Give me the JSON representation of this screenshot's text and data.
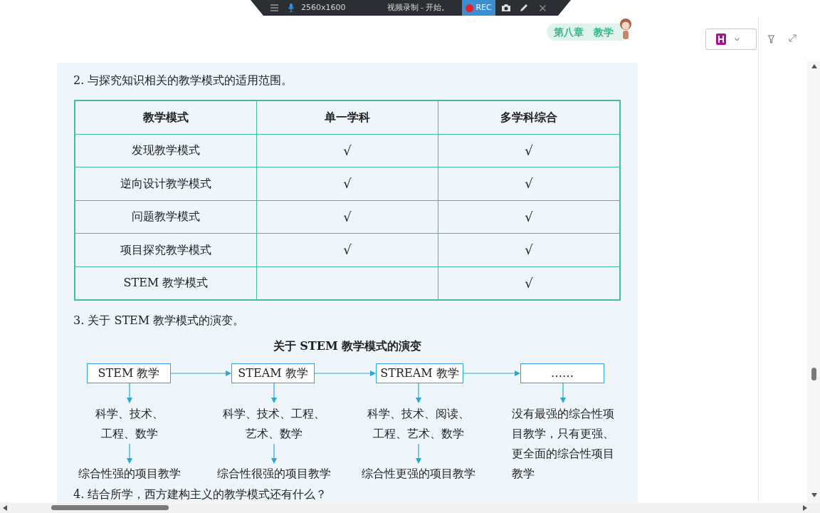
{
  "recorder_bar": {
    "resolution": "2560x1600",
    "title": "视频录制 - 开始。",
    "rec_button": "REC"
  },
  "chapter_tag": "第八章　教学",
  "section_2": {
    "heading": "2. 与探究知识相关的教学模式的适用范围。",
    "table": {
      "columns": [
        "教学模式",
        "单一学科",
        "多学科综合"
      ],
      "rows": [
        {
          "mode": "发现教学模式",
          "single": "√",
          "multi": "√"
        },
        {
          "mode": "逆向设计教学模式",
          "single": "√",
          "multi": "√"
        },
        {
          "mode": "问题教学模式",
          "single": "√",
          "multi": "√"
        },
        {
          "mode": "项目探究教学模式",
          "single": "√",
          "multi": "√"
        },
        {
          "mode": "STEM 教学模式",
          "multi": "√"
        }
      ]
    }
  },
  "section_3": {
    "heading": "3. 关于 STEM 教学模式的演变。",
    "diagram_title": "关于 STEM 教学模式的演变",
    "stages": [
      {
        "name": "STEM 教学",
        "subjects": [
          "科学、技术、",
          "工程、数学"
        ],
        "result": "综合性强的项目教学"
      },
      {
        "name": "STEAM 教学",
        "subjects": [
          "科学、技术、工程、",
          "艺术、数学"
        ],
        "result": "综合性很强的项目教学"
      },
      {
        "name": "STREAM 教学",
        "subjects": [
          "科学、技术、阅读、",
          "工程、艺术、数学"
        ],
        "result": "综合性更强的项目教学"
      },
      {
        "name": "……",
        "subjects": [
          "没有最强的综合性项",
          "目教学，只有更强、",
          "更全面的综合性项目",
          "教学"
        ]
      }
    ]
  },
  "section_4": {
    "heading": "4. 结合所学，西方建构主义的教学模式还有什么？"
  }
}
